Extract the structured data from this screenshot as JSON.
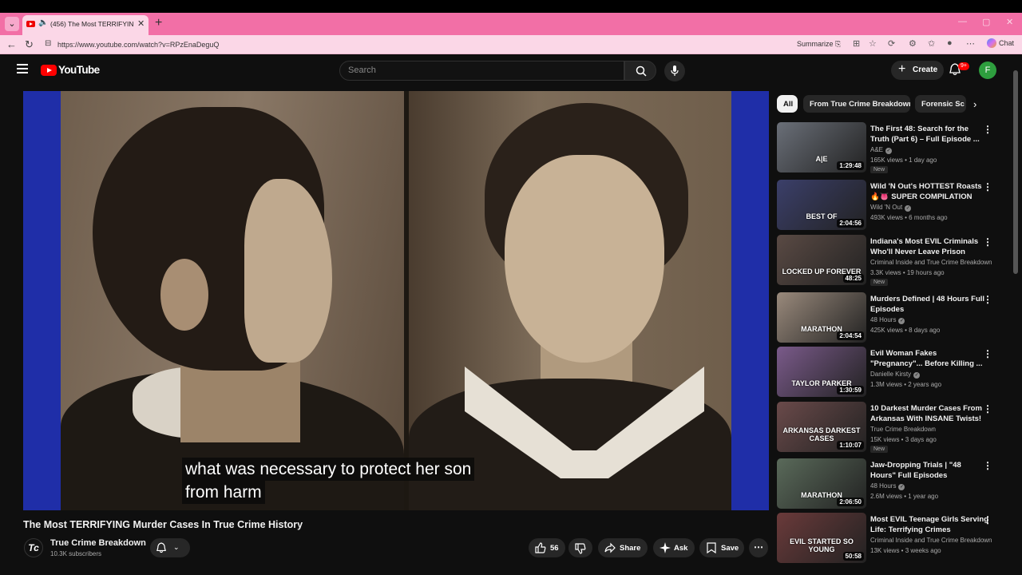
{
  "browser": {
    "tab_title": "(456) The Most TERRIFYING Murder Cases In True Crime History - YouTube",
    "url": "https://www.youtube.com/watch?v=RPzEnaDeguQ",
    "summarize_label": "Summarize",
    "chat_label": "Chat"
  },
  "header": {
    "logo_text": "YouTube",
    "search_placeholder": "Search",
    "create_label": "Create",
    "notification_count": "9+",
    "avatar_letter": "F"
  },
  "video": {
    "caption_line1": "what was necessary to protect her son",
    "caption_line2": "from harm",
    "title": "The Most TERRIFYING Murder Cases In True Crime History",
    "channel_logo": "Tc",
    "channel_name": "True Crime Breakdown",
    "subscribers": "10.3K subscribers",
    "like_count": "56",
    "share_label": "Share",
    "ask_label": "Ask",
    "save_label": "Save"
  },
  "chips": [
    "All",
    "From True Crime Breakdown",
    "Forensic Sc"
  ],
  "recommendations": [
    {
      "title": "The First 48: Search for the Truth (Part 6) – Full Episode ...",
      "channel": "A&E",
      "verified": true,
      "meta": "165K views • 1 day ago",
      "new": "New",
      "duration": "1:29:48",
      "thumb_text": "A|E",
      "color": "#6a6f78"
    },
    {
      "title": "Wild 'N Out's HOTTEST Roasts 🔥👅 SUPER COMPILATION",
      "channel": "Wild 'N Out",
      "verified": true,
      "meta": "493K views • 6 months ago",
      "new": "",
      "duration": "2:04:56",
      "thumb_text": "BEST OF",
      "color": "#3b3f6a"
    },
    {
      "title": "Indiana's Most EVIL Criminals Who'll Never Leave Prison",
      "channel": "Criminal Inside and True Crime Breakdown",
      "verified": false,
      "meta": "3.3K views • 19 hours ago",
      "new": "New",
      "duration": "48:25",
      "thumb_text": "LOCKED UP FOREVER",
      "color": "#5a4a44"
    },
    {
      "title": "Murders Defined | 48 Hours Full Episodes",
      "channel": "48 Hours",
      "verified": true,
      "meta": "425K views • 8 days ago",
      "new": "",
      "duration": "2:04:54",
      "thumb_text": "MARATHON",
      "color": "#9a8a7c"
    },
    {
      "title": "Evil Woman Fakes \"Pregnancy\"... Before Killing ...",
      "channel": "Danielle Kirsty",
      "verified": true,
      "meta": "1.3M views • 2 years ago",
      "new": "",
      "duration": "1:30:59",
      "thumb_text": "TAYLOR PARKER",
      "color": "#7a5a8a"
    },
    {
      "title": "10 Darkest Murder Cases From Arkansas With INSANE Twists!",
      "channel": "True Crime Breakdown",
      "verified": false,
      "meta": "15K views • 3 days ago",
      "new": "New",
      "duration": "1:10:07",
      "thumb_text": "ARKANSAS DARKEST CASES",
      "color": "#6a4a4a"
    },
    {
      "title": "Jaw-Dropping Trials | \"48 Hours\" Full Episodes",
      "channel": "48 Hours",
      "verified": true,
      "meta": "2.6M views • 1 year ago",
      "new": "",
      "duration": "2:06:50",
      "thumb_text": "MARATHON",
      "color": "#5a6a5a"
    },
    {
      "title": "Most EVIL Teenage Girls Serving Life: Terrifying Crimes",
      "channel": "Criminal Inside and True Crime Breakdown",
      "verified": false,
      "meta": "13K views • 3 weeks ago",
      "new": "",
      "duration": "50:58",
      "thumb_text": "EVIL STARTED SO YOUNG",
      "color": "#6a3a3a"
    }
  ]
}
